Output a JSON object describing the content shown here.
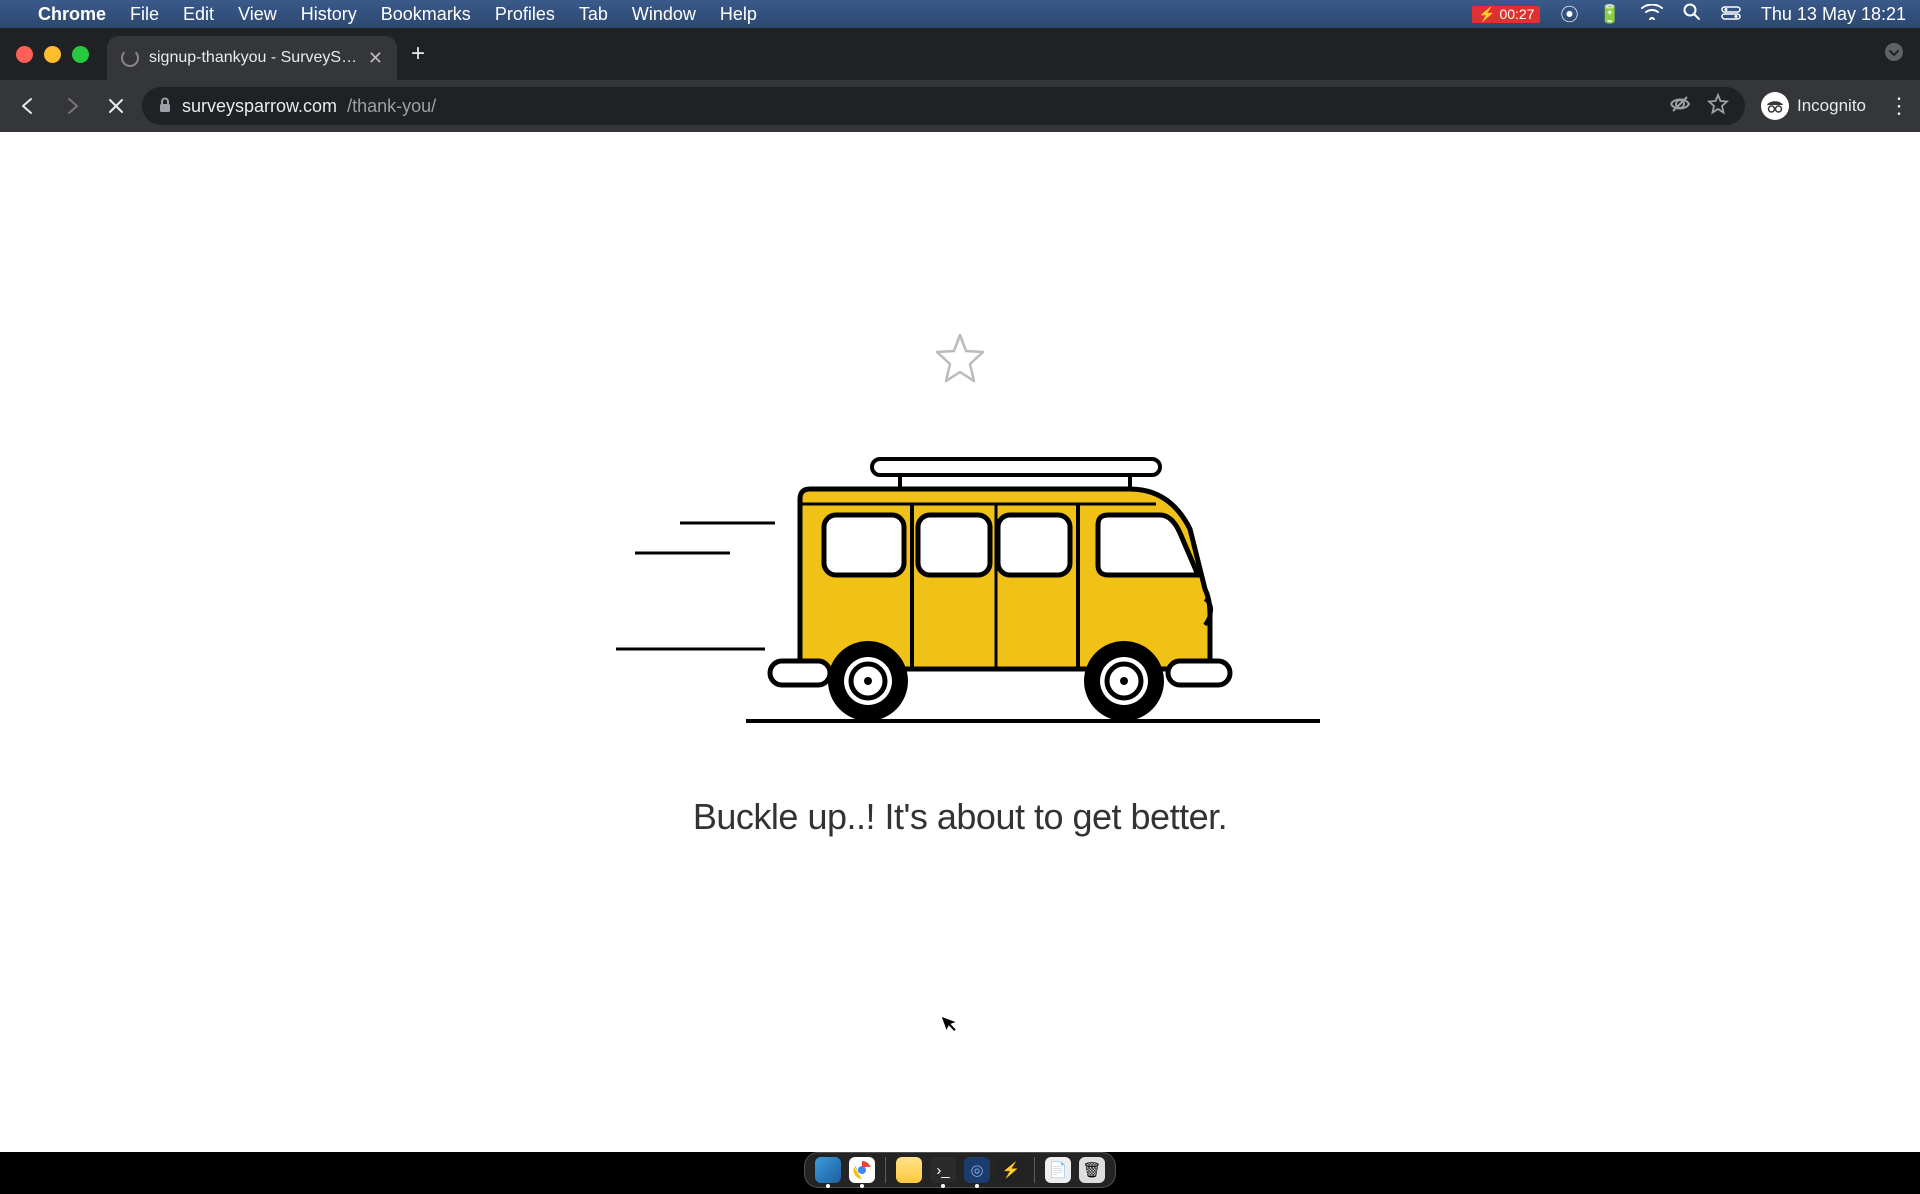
{
  "menubar": {
    "apple": "",
    "app_name": "Chrome",
    "items": [
      "File",
      "Edit",
      "View",
      "History",
      "Bookmarks",
      "Profiles",
      "Tab",
      "Window",
      "Help"
    ],
    "battery_time": "00:27",
    "date_time": "Thu 13 May  18:21"
  },
  "browser": {
    "tab_title": "signup-thankyou - SurveySparrow",
    "url_host": "surveysparrow.com",
    "url_path": "/thank-you/",
    "incognito_label": "Incognito"
  },
  "page": {
    "message": "Buckle up..! It's about to get better."
  },
  "colors": {
    "bus_yellow": "#f0c217"
  }
}
